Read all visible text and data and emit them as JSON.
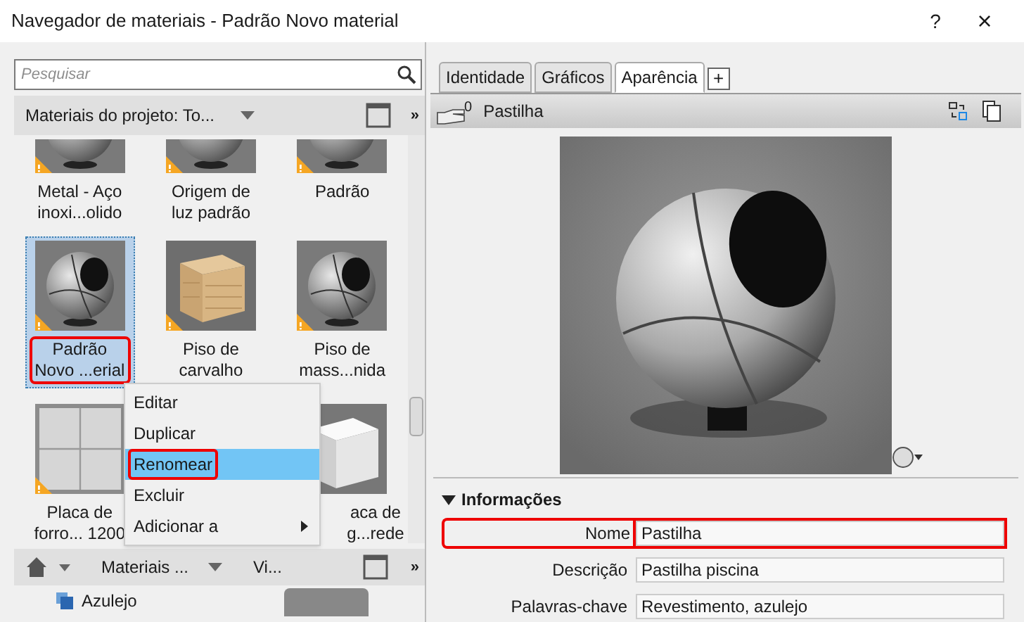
{
  "window": {
    "title": "Navegador de materiais - Padrão Novo material",
    "help": "?",
    "close": "×"
  },
  "search": {
    "placeholder": "Pesquisar"
  },
  "library_bar": {
    "label": "Materiais do projeto: To...",
    "more": "»"
  },
  "materials": [
    {
      "kind": "sphere",
      "partial": true,
      "selected": false,
      "label_lines": [
        "Metal - Aço",
        "inoxi...olido"
      ]
    },
    {
      "kind": "sphere",
      "partial": true,
      "selected": false,
      "label_lines": [
        "Origem de",
        "luz padrão"
      ]
    },
    {
      "kind": "sphere",
      "partial": true,
      "selected": false,
      "label_lines": [
        "Padrão"
      ]
    },
    {
      "kind": "pool",
      "partial": false,
      "selected": true,
      "annotated": true,
      "label_lines": [
        "Padrão",
        "Novo ...erial"
      ]
    },
    {
      "kind": "wood",
      "partial": false,
      "selected": false,
      "label_lines": [
        "Piso de",
        "carvalho"
      ]
    },
    {
      "kind": "pool",
      "partial": false,
      "selected": false,
      "label_lines": [
        "Piso de",
        "mass...nida"
      ]
    },
    {
      "kind": "tile",
      "partial": false,
      "selected": false,
      "label_lines": [
        "Placa de",
        "forro... 1200"
      ]
    },
    {
      "kind": "covered"
    },
    {
      "kind": "cube",
      "partial": false,
      "selected": false,
      "covered": true,
      "label_lines": [
        "aca de",
        "g...rede"
      ]
    }
  ],
  "context_menu": [
    {
      "label": "Editar",
      "selected": false,
      "annotated": false,
      "has_submenu": false
    },
    {
      "label": "Duplicar",
      "selected": false,
      "annotated": false,
      "has_submenu": false
    },
    {
      "label": "Renomear",
      "selected": true,
      "annotated": true,
      "has_submenu": false
    },
    {
      "label": "Excluir",
      "selected": false,
      "annotated": false,
      "has_submenu": false
    },
    {
      "label": "Adicionar a",
      "selected": false,
      "annotated": false,
      "has_submenu": true
    }
  ],
  "library_breadcrumb": {
    "segments": [
      "Materiais ...",
      "Vi..."
    ],
    "more": "»"
  },
  "library_tree": [
    {
      "label": "Azulejo"
    }
  ],
  "tabs": [
    {
      "label": "Identidade",
      "selected": false
    },
    {
      "label": "Gráficos",
      "selected": false
    },
    {
      "label": "Aparência",
      "selected": true
    }
  ],
  "add_tab": "+",
  "asset": {
    "count": "0",
    "name": "Pastilha"
  },
  "info": {
    "title": "Informações",
    "expanded": true,
    "fields": [
      {
        "label": "Nome",
        "value": "Pastilha",
        "annotated": true
      },
      {
        "label": "Descrição",
        "value": "Pastilha piscina",
        "annotated": false
      },
      {
        "label": "Palavras-chave",
        "value": "Revestimento, azulejo",
        "annotated": false
      }
    ]
  }
}
